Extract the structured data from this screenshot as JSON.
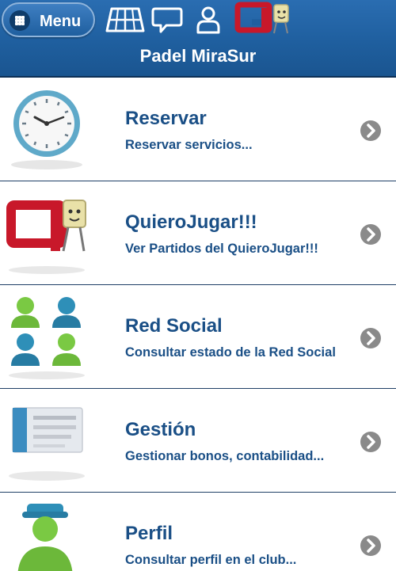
{
  "header": {
    "menu_label": "Menu",
    "title": "Padel MiraSur",
    "icons": [
      "court-icon",
      "chat-icon",
      "user-icon",
      "quierojugar-logo-icon"
    ]
  },
  "colors": {
    "header_bg": "#1f5f9f",
    "text_blue": "#1a4f86",
    "chevron_grey": "#8a8a8a"
  },
  "items": [
    {
      "label": "Reservar",
      "description": "Reservar servicios...",
      "icon": "clock-icon"
    },
    {
      "label": "QuieroJugar!!!",
      "description": "Ver Partidos del QuieroJugar!!!",
      "icon": "quierojugar-logo-icon"
    },
    {
      "label": "Red Social",
      "description": "Consultar estado de la Red Social",
      "icon": "people-group-icon"
    },
    {
      "label": "Gestión",
      "description": "Gestionar bonos, contabilidad...",
      "icon": "document-icon"
    },
    {
      "label": "Perfil",
      "description": "Consultar perfil en el club...",
      "icon": "player-profile-icon"
    }
  ]
}
